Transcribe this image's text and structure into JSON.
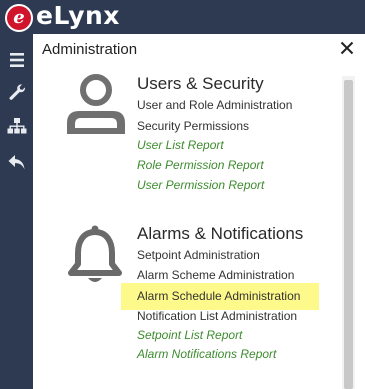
{
  "brand": {
    "logo_letter": "e",
    "name": "eLynx"
  },
  "left_nav": {
    "items": [
      {
        "icon": "hamburger-menu-icon"
      },
      {
        "icon": "wrench-icon"
      },
      {
        "icon": "hierarchy-icon"
      },
      {
        "icon": "back-arrow-icon"
      }
    ]
  },
  "panel": {
    "title": "Administration",
    "close_icon": "close-icon"
  },
  "sections": [
    {
      "title": "Users & Security",
      "icon": "user-icon",
      "items": [
        {
          "label": "User and Role Administration",
          "type": "admin"
        },
        {
          "label": "Security Permissions",
          "type": "admin"
        },
        {
          "label": "User List Report",
          "type": "report"
        },
        {
          "label": "Role Permission Report",
          "type": "report"
        },
        {
          "label": "User Permission Report",
          "type": "report"
        }
      ]
    },
    {
      "title": "Alarms & Notifications",
      "icon": "bell-icon",
      "items": [
        {
          "label": "Setpoint Administration",
          "type": "admin"
        },
        {
          "label": "Alarm Scheme Administration",
          "type": "admin"
        },
        {
          "label": "Alarm Schedule Administration",
          "type": "admin",
          "highlighted": true
        },
        {
          "label": "Notification List Administration",
          "type": "admin"
        },
        {
          "label": "Setpoint List Report",
          "type": "report"
        },
        {
          "label": "Alarm Notifications Report",
          "type": "report"
        }
      ]
    }
  ],
  "colors": {
    "nav_background": "#2d3a52",
    "logo_red": "#d0142c",
    "report_link": "#3d8b2f",
    "highlight": "#fdf98a"
  }
}
